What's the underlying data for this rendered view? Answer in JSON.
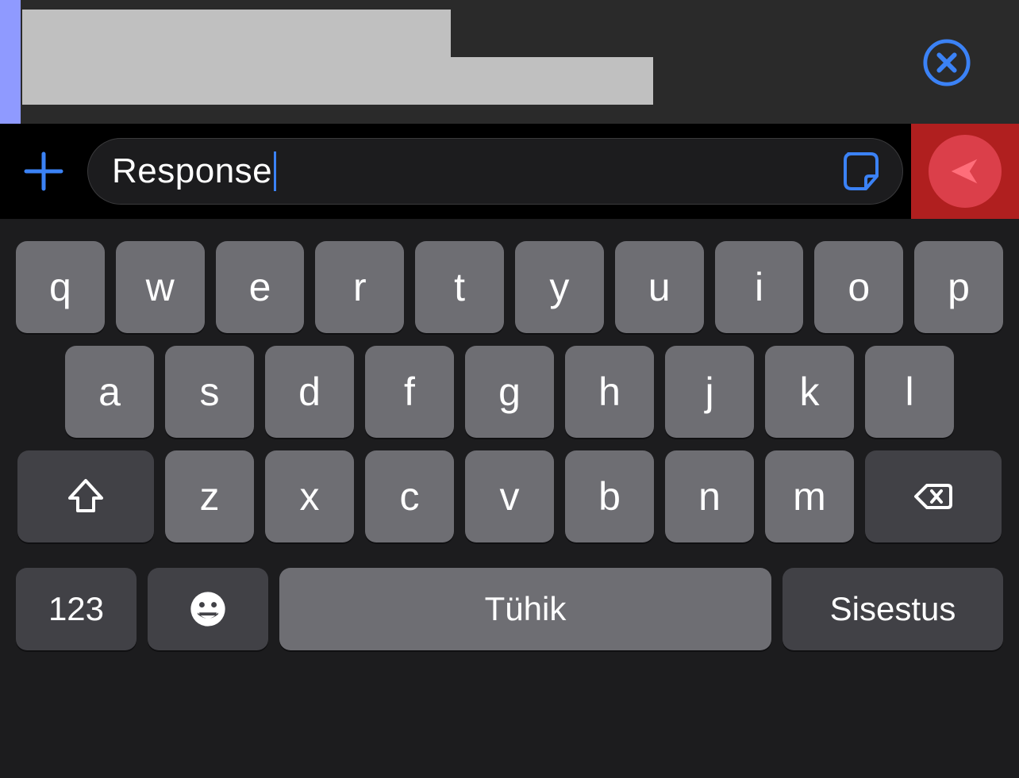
{
  "colors": {
    "accent_blue": "#3b82f6",
    "send_highlight": "#b01f1f"
  },
  "header": {
    "close_icon": "close-circle"
  },
  "input": {
    "value": "Response",
    "placeholder": "",
    "plus_icon": "plus",
    "sticker_icon": "sticker",
    "send_icon": "send"
  },
  "keyboard": {
    "row1": [
      "q",
      "w",
      "e",
      "r",
      "t",
      "y",
      "u",
      "i",
      "o",
      "p"
    ],
    "row2": [
      "a",
      "s",
      "d",
      "f",
      "g",
      "h",
      "j",
      "k",
      "l"
    ],
    "row3": [
      "z",
      "x",
      "c",
      "v",
      "b",
      "n",
      "m"
    ],
    "shift_icon": "shift",
    "backspace_icon": "backspace",
    "numbers_label": "123",
    "emoji_icon": "emoji",
    "space_label": "Tühik",
    "enter_label": "Sisestus"
  }
}
